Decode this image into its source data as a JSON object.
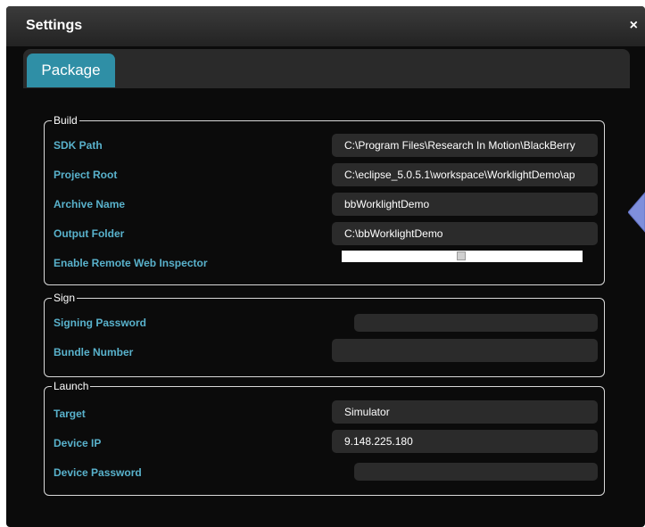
{
  "dialog": {
    "title": "Settings",
    "close_label": "×"
  },
  "tabs": [
    {
      "label": "Package"
    }
  ],
  "build": {
    "legend": "Build",
    "sdk_path": {
      "label": "SDK Path",
      "value": "C:\\Program Files\\Research In Motion\\BlackBerry"
    },
    "project_root": {
      "label": "Project Root",
      "value": "C:\\eclipse_5.0.5.1\\workspace\\WorklightDemo\\ap"
    },
    "archive_name": {
      "label": "Archive Name",
      "value": "bbWorklightDemo"
    },
    "output_folder": {
      "label": "Output Folder",
      "value": "C:\\bbWorklightDemo"
    },
    "remote_inspector": {
      "label": "Enable Remote Web Inspector",
      "enabled": false
    }
  },
  "sign": {
    "legend": "Sign",
    "signing_password": {
      "label": "Signing Password",
      "value": ""
    },
    "bundle_number": {
      "label": "Bundle Number",
      "value": ""
    }
  },
  "launch": {
    "legend": "Launch",
    "target": {
      "label": "Target",
      "value": "Simulator"
    },
    "device_ip": {
      "label": "Device IP",
      "value": "9.148.225.180"
    },
    "device_password": {
      "label": "Device Password",
      "value": ""
    }
  },
  "colors": {
    "accent": "#2f8fa6",
    "label": "#59b2cc",
    "arrow": "#7f8fdc"
  },
  "icons": {
    "close": "close-icon",
    "arrow": "arrow-left-icon"
  }
}
